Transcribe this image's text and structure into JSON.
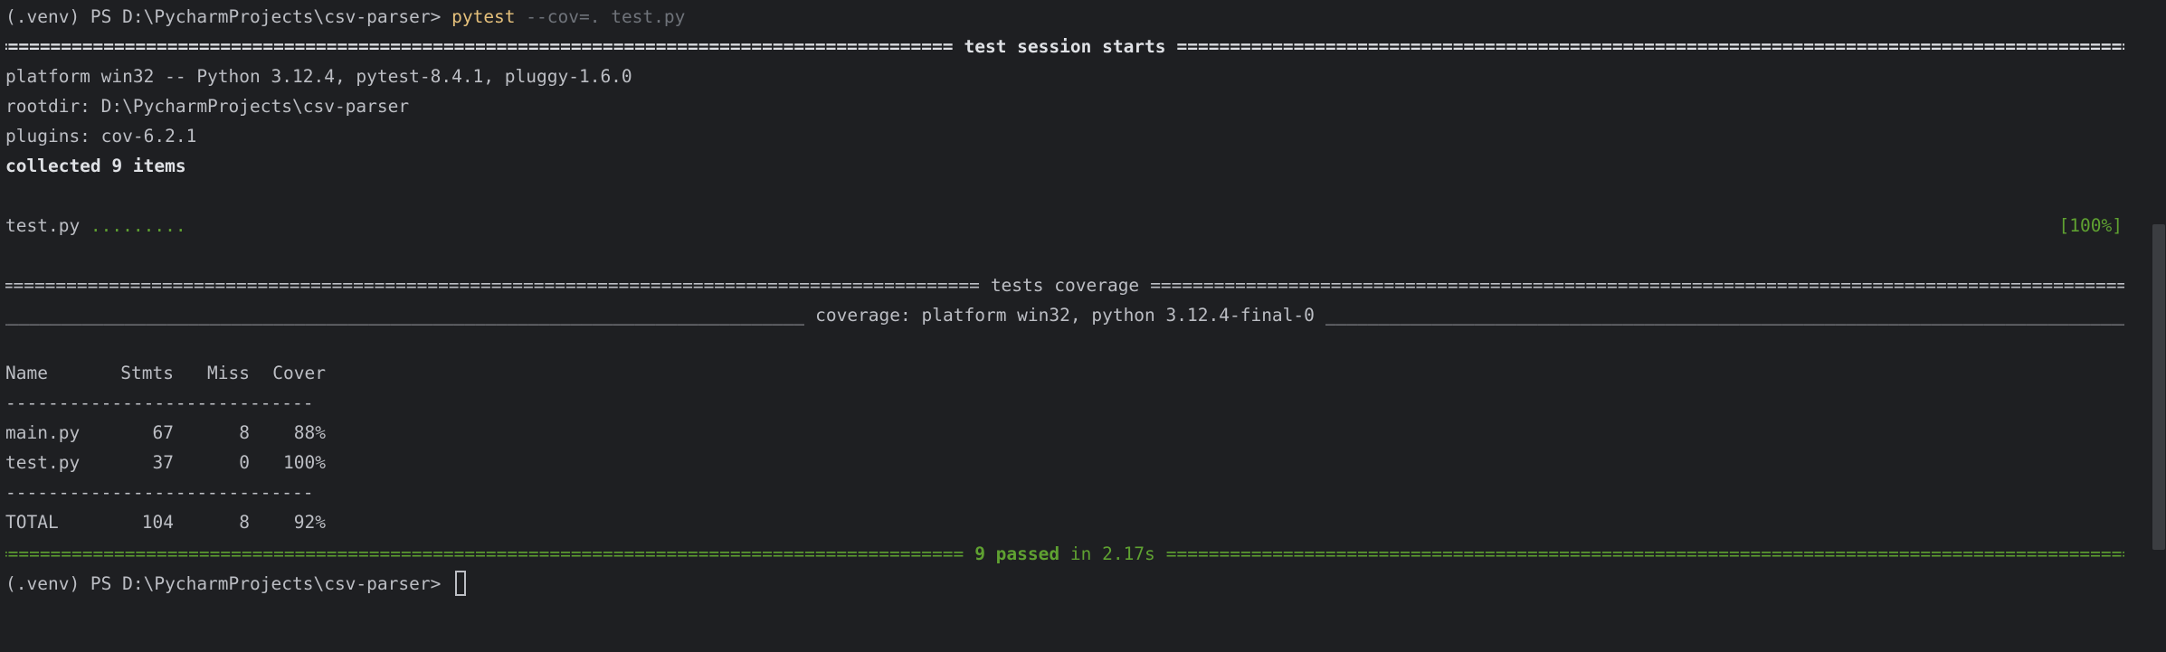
{
  "prompt": {
    "prefix": "(.venv) PS D:\\PycharmProjects\\csv-parser> ",
    "command": "pytest",
    "args": " --cov=. test.py"
  },
  "session": {
    "header": "test session starts",
    "platform": "platform win32 -- Python 3.12.4, pytest-8.4.1, pluggy-1.6.0",
    "rootdir": "rootdir: D:\\PycharmProjects\\csv-parser",
    "plugins": "plugins: cov-6.2.1",
    "collected": "collected 9 items",
    "test_file": "test.py ",
    "test_dots": ".........",
    "progress": "[100%]"
  },
  "coverage": {
    "header": "tests coverage",
    "subheader": "coverage: platform win32, python 3.12.4-final-0",
    "columns": [
      "Name",
      "Stmts",
      "Miss",
      "Cover"
    ],
    "separator": "-----------------------------",
    "rows": [
      [
        "main.py",
        "67",
        "8",
        "88%"
      ],
      [
        "test.py",
        "37",
        "0",
        "100%"
      ]
    ],
    "total": [
      "TOTAL",
      "104",
      "8",
      "92%"
    ]
  },
  "result": {
    "passed": "9 passed",
    "time": " in 2.17s"
  },
  "prompt_end": {
    "prefix": "(.venv) PS D:\\PycharmProjects\\csv-parser> "
  },
  "colors": {
    "background": "#1e1f22",
    "text": "#bcbec4",
    "command": "#e5c07b",
    "success": "#5fa131",
    "dim": "#6f737a"
  }
}
